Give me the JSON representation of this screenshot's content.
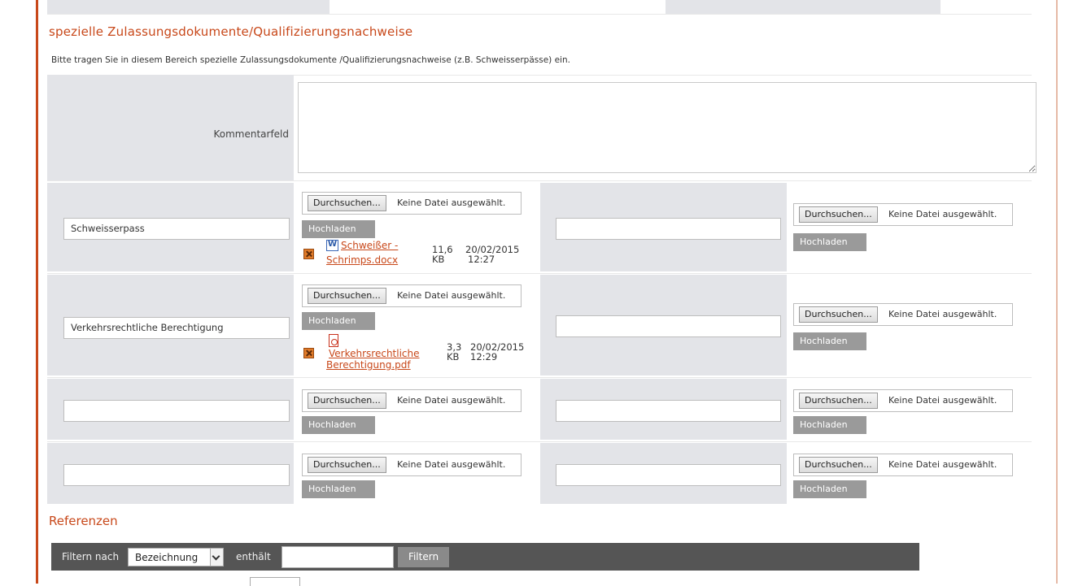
{
  "section": {
    "title": "spezielle Zulassungsdokumente/Qualifizierungsnachweise",
    "intro": "Bitte tragen Sie in diesem Bereich spezielle Zulassungsdokumente /Qualifizierungsnachweise (z.B. Schweisserpässe) ein.",
    "comment_label": "Kommentarfeld",
    "comment_value": ""
  },
  "labels": {
    "browse": "Durchsuchen...",
    "no_file": "Keine Datei ausgewählt.",
    "upload": "Hochladen"
  },
  "rows": [
    {
      "name": "Schweisserpass",
      "right_name": "",
      "file": {
        "name": "Schweißer - Schrimps.docx",
        "name_line1": "Schweißer -",
        "name_line2": "Schrimps.docx",
        "size_num": "11,6",
        "size_unit": "KB",
        "date": "20/02/2015",
        "time": "12:27",
        "icon": "word-doc-icon"
      }
    },
    {
      "name": "Verkehrsrechtliche Berechtigung",
      "right_name": "",
      "file": {
        "name": "Verkehrsrechtliche Berechtigung.pdf",
        "name_line1": "Verkehrsrechtliche",
        "name_line2": "Berechtigung.pdf",
        "size_num": "3,3",
        "size_unit": "KB",
        "date": "20/02/2015",
        "time": "12:29",
        "icon": "pdf-icon"
      }
    },
    {
      "name": "",
      "right_name": ""
    },
    {
      "name": "",
      "right_name": ""
    }
  ],
  "references": {
    "title": "Referenzen",
    "filter_by_label": "Filtern nach",
    "filter_select_value": "Bezeichnung",
    "contains_label": "enthält",
    "filter_value": "",
    "filter_button": "Filtern"
  },
  "colors": {
    "accent": "#c8481a",
    "cell_gray": "#e3e4e8",
    "button_gray": "#9a9a9a",
    "filter_bar": "#555555"
  }
}
